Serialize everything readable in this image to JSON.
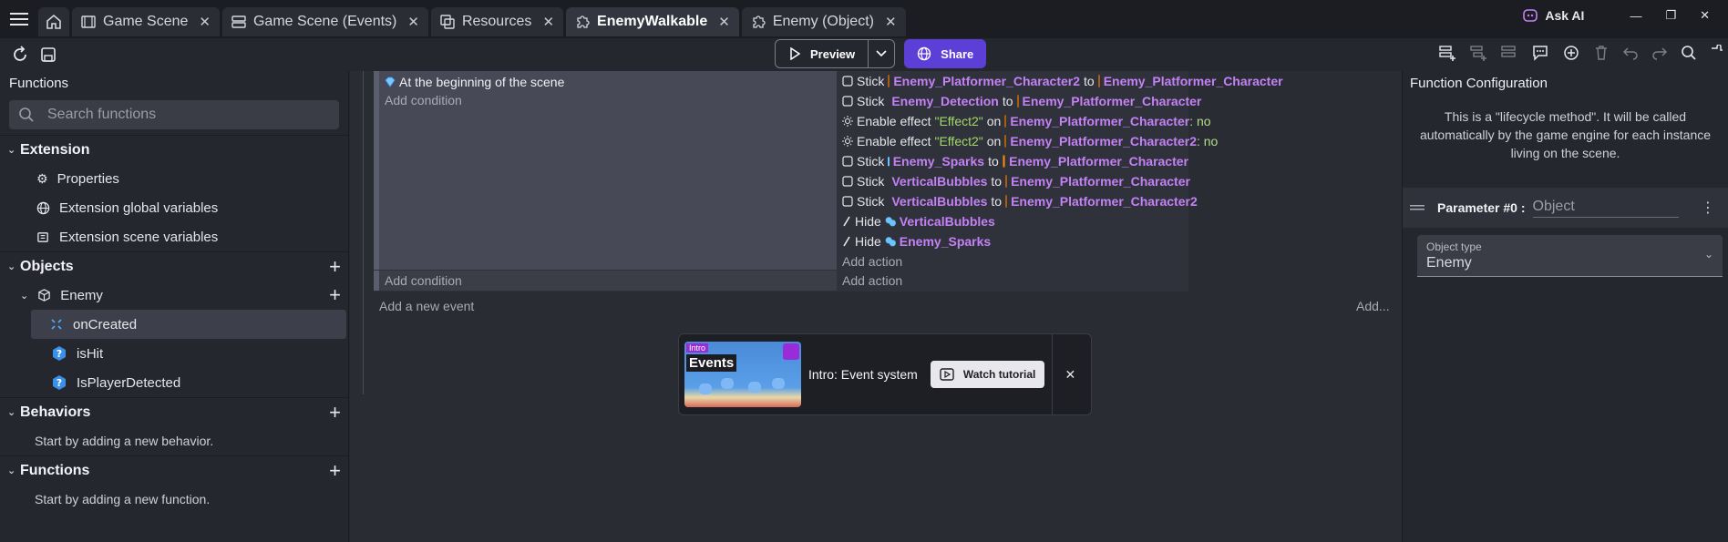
{
  "tabs": [
    {
      "label": "Game Scene",
      "icon": "film-icon",
      "active": false
    },
    {
      "label": "Game Scene (Events)",
      "icon": "events-list-icon",
      "active": false
    },
    {
      "label": "Resources",
      "icon": "resources-icon",
      "active": false
    },
    {
      "label": "EnemyWalkable",
      "icon": "puzzle-icon",
      "active": true
    },
    {
      "label": "Enemy (Object)",
      "icon": "puzzle-icon",
      "active": false
    }
  ],
  "window": {
    "ask_ai_label": "Ask AI",
    "minimize": "—",
    "restore": "❐",
    "close": "✕"
  },
  "toolbar": {
    "preview_label": "Preview",
    "share_label": "Share"
  },
  "left_panel": {
    "title": "Functions",
    "search_placeholder": "Search functions",
    "extension": {
      "title": "Extension",
      "items": [
        "Properties",
        "Extension global variables",
        "Extension scene variables"
      ]
    },
    "objects": {
      "title": "Objects",
      "object_name": "Enemy",
      "functions": [
        "onCreated",
        "isHit",
        "IsPlayerDetected"
      ]
    },
    "behaviors": {
      "title": "Behaviors",
      "hint": "Start by adding a new behavior."
    },
    "functions": {
      "title": "Functions",
      "hint": "Start by adding a new function."
    }
  },
  "events": {
    "condition": "At the beginning of the scene",
    "add_condition": "Add condition",
    "add_action": "Add action",
    "add_new_event": "Add a new event",
    "add_more": "Add...",
    "actions": [
      {
        "icon": "sticker-icon",
        "verb": "Stick",
        "obj1_icon": "orange",
        "obj1": "Enemy_Platformer_Character2",
        "mid": "to",
        "obj2_icon": "orange",
        "obj2": "Enemy_Platformer_Character",
        "tail": ""
      },
      {
        "icon": "sticker-icon",
        "verb": "Stick",
        "obj1_icon": "black",
        "obj1": "Enemy_Detection",
        "mid": "to",
        "obj2_icon": "orange",
        "obj2": "Enemy_Platformer_Character",
        "tail": ""
      },
      {
        "icon": "effect-icon",
        "verb": "Enable effect",
        "str": "\"Effect2\"",
        "mid": "on",
        "obj2_icon": "orange",
        "obj2": "Enemy_Platformer_Character",
        "tail": ": no"
      },
      {
        "icon": "effect-icon",
        "verb": "Enable effect",
        "str": "\"Effect2\"",
        "mid": "on",
        "obj2_icon": "orange",
        "obj2": "Enemy_Platformer_Character2",
        "tail": ": no"
      },
      {
        "icon": "sticker-icon",
        "verb": "Stick",
        "obj1_icon": "part",
        "obj1": "Enemy_Sparks",
        "mid": "to",
        "obj2_icon": "orange",
        "obj2": "Enemy_Platformer_Character",
        "tail": ""
      },
      {
        "icon": "sticker-icon",
        "verb": "Stick",
        "obj1_icon": "part",
        "obj1": "VerticalBubbles",
        "mid": "to",
        "obj2_icon": "orange",
        "obj2": "Enemy_Platformer_Character",
        "tail": ""
      },
      {
        "icon": "sticker-icon",
        "verb": "Stick",
        "obj1_icon": "part",
        "obj1": "VerticalBubbles",
        "mid": "to",
        "obj2_icon": "orange",
        "obj2": "Enemy_Platformer_Character2",
        "tail": ""
      },
      {
        "icon": "hide-icon",
        "verb": "Hide",
        "obj1_icon": "part",
        "obj1": "VerticalBubbles",
        "mid": "",
        "tail": ""
      },
      {
        "icon": "hide-icon",
        "verb": "Hide",
        "obj1_icon": "part",
        "obj1": "Enemy_Sparks",
        "mid": "",
        "tail": ""
      }
    ]
  },
  "tutorial": {
    "thumb_tag": "Intro",
    "thumb_title": "Events",
    "title": "Intro: Event system",
    "button_label": "Watch tutorial",
    "close": "✕"
  },
  "right_panel": {
    "title": "Function Configuration",
    "lifecycle_text": "This is a \"lifecycle method\". It will be called automatically by the game engine for each instance living on the scene.",
    "parameter_label": "Parameter #0 :",
    "parameter_value": "Object",
    "object_type_label": "Object type",
    "object_type_value": "Enemy"
  },
  "colors": {
    "accent": "#5b3fd6",
    "object_name": "#c481f5",
    "string": "#a5d66b"
  }
}
